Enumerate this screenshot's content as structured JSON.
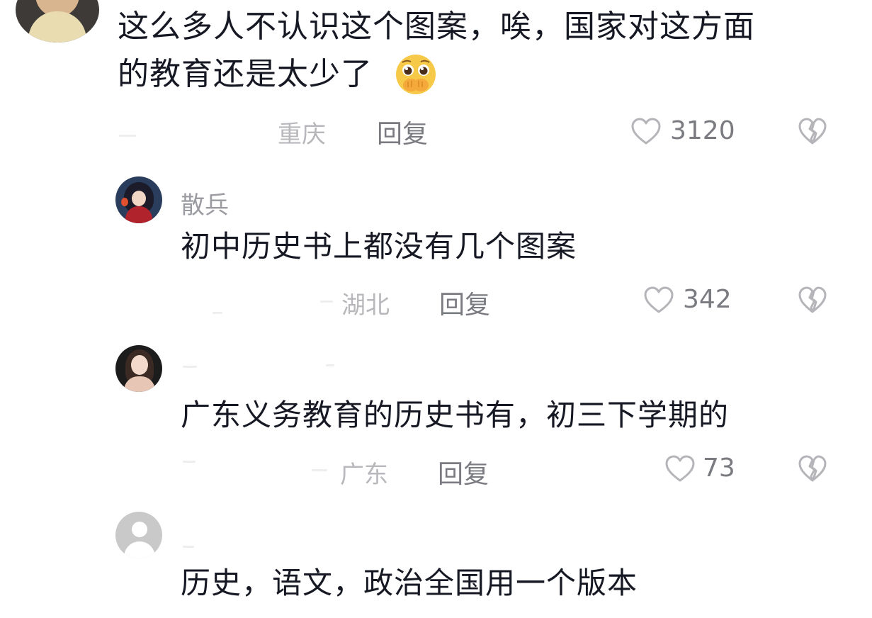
{
  "comment": {
    "line1": "这么多人不认识这个图案，唉，国家对这方面",
    "line2": "的教育还是太少了",
    "emoji": "pleading-face-hands-covering-mouth",
    "location": "重庆",
    "reply_label": "回复",
    "likes": "3120"
  },
  "replies": [
    {
      "username": "散兵",
      "text": "初中历史书上都没有几个图案",
      "location": "湖北",
      "reply_label": "回复",
      "likes": "342"
    },
    {
      "username": "",
      "text": "广东义务教育的历史书有，初三下学期的",
      "location": "广东",
      "reply_label": "回复",
      "likes": "73"
    },
    {
      "username": "",
      "text": "历史，语文，政治全国用一个版本"
    }
  ],
  "colors": {
    "text": "#161823",
    "muted": "#7a7b80",
    "location": "#b8b8bc",
    "icon": "#b5b5b9"
  }
}
